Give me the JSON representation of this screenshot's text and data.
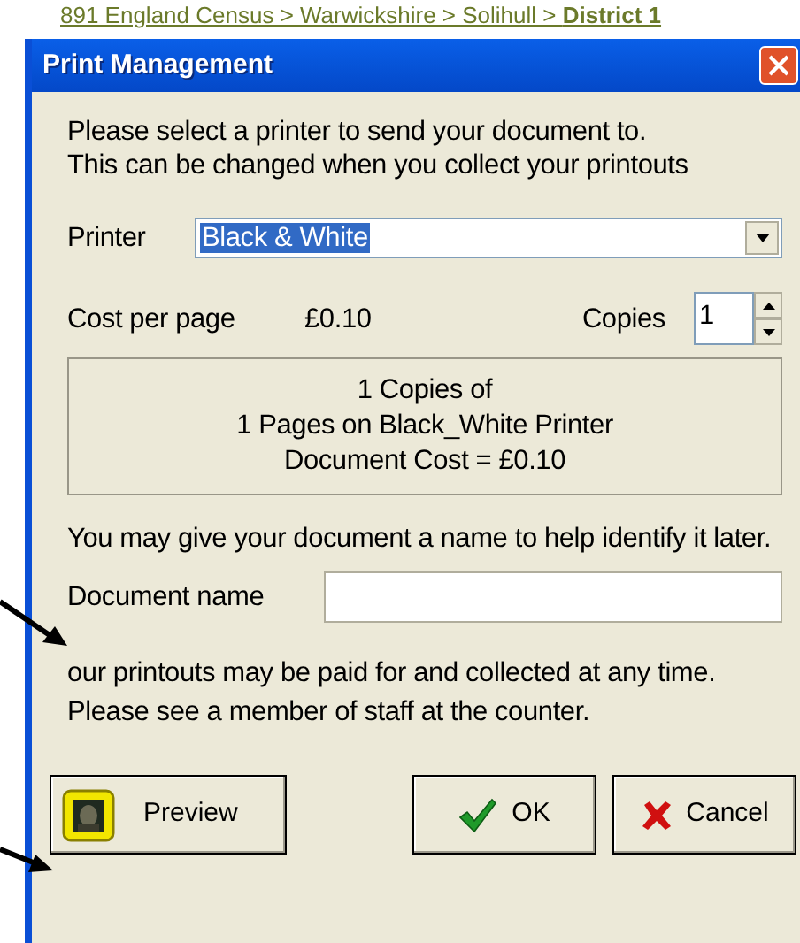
{
  "breadcrumb": "891 England Census > Warwickshire > Solihull > **District 1**",
  "dialog": {
    "title": "Print Management",
    "intro": [
      "Please select a printer to send your document to.",
      "This can be changed when you collect your printouts"
    ],
    "printer": {
      "label": "Printer",
      "value": "Black & White"
    },
    "cost": {
      "label": "Cost per page",
      "value": "£0.10"
    },
    "copies": {
      "label": "Copies",
      "value": "1"
    },
    "summary": [
      "1 Copies of",
      "1 Pages on Black_White Printer",
      "Document Cost = £0.10"
    ],
    "name_hint": "You may give your document a name to help identify it later.",
    "document_name": {
      "label": "Document name"
    },
    "payment_note": "our printouts may be paid for and collected at any time. Please see a member of staff at the counter.",
    "buttons": [
      {
        "kind": "preview",
        "label": "Preview"
      },
      {
        "kind": "ok",
        "label": "OK"
      },
      {
        "kind": "cancel",
        "label": "Cancel"
      }
    ]
  }
}
